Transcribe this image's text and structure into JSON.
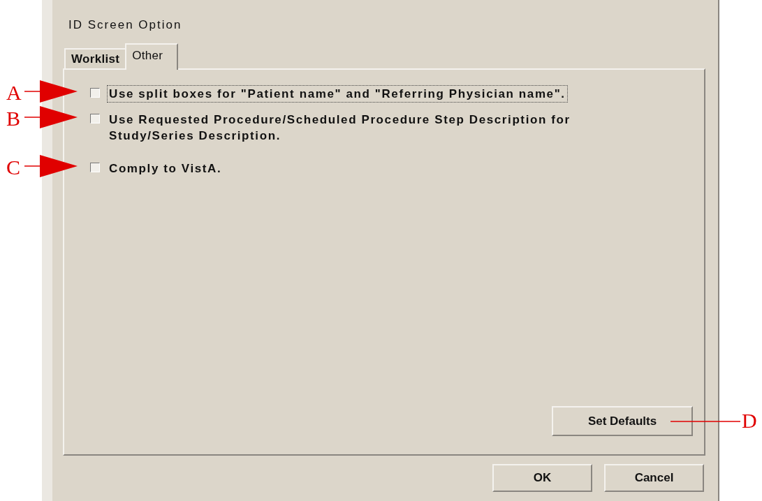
{
  "window": {
    "title": "ID Screen Option"
  },
  "tabs": [
    {
      "label": "Worklist",
      "selected": false
    },
    {
      "label": "Other",
      "selected": true
    }
  ],
  "options": [
    {
      "label": "Use split boxes for \"Patient name\" and \"Referring Physician name\".",
      "checked": false,
      "focused": true,
      "callout": "A"
    },
    {
      "label": "Use Requested Procedure/Scheduled Procedure Step Description for Study/Series Description.",
      "checked": false,
      "focused": false,
      "callout": "B"
    },
    {
      "label": "Comply to VistA.",
      "checked": false,
      "focused": false,
      "callout": "C"
    }
  ],
  "panel_button": {
    "label": "Set Defaults",
    "callout": "D"
  },
  "buttons": [
    "OK",
    "Cancel"
  ]
}
